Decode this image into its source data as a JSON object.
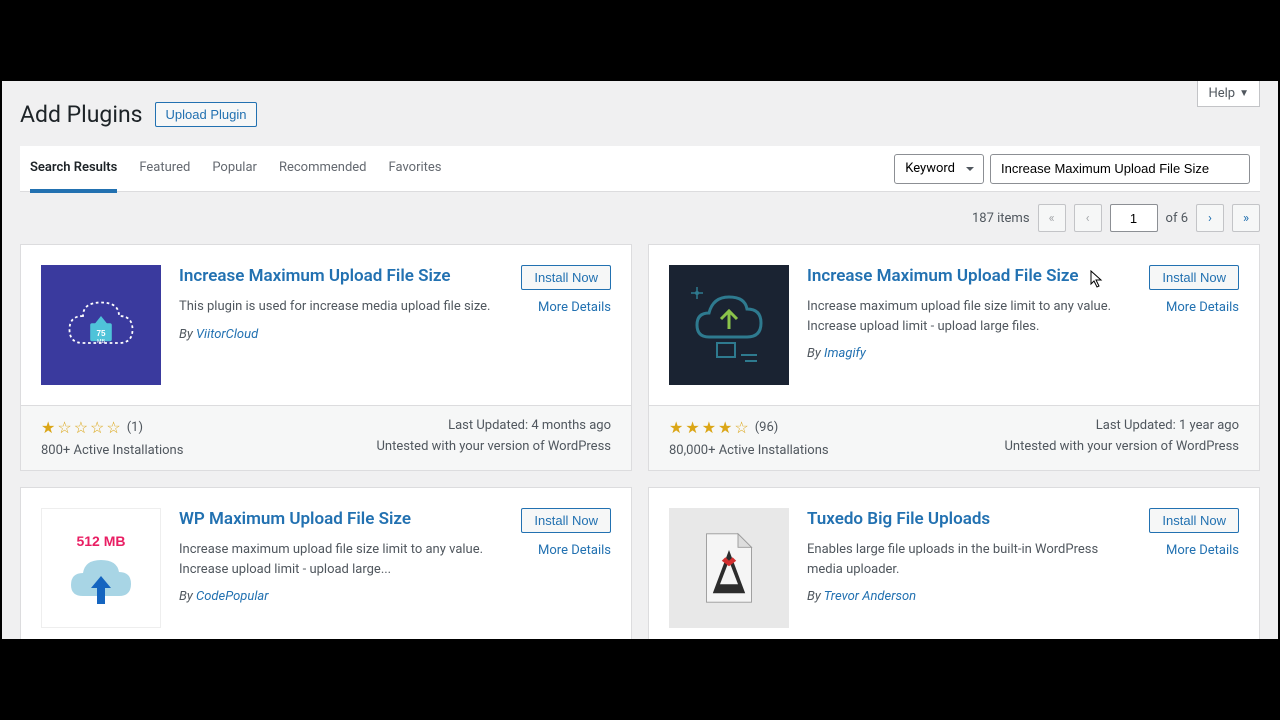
{
  "header": {
    "help_label": "Help",
    "page_title": "Add Plugins",
    "upload_label": "Upload Plugin"
  },
  "tabs": {
    "items": [
      "Search Results",
      "Featured",
      "Popular",
      "Recommended",
      "Favorites"
    ],
    "active": 0
  },
  "search": {
    "type_label": "Keyword",
    "query": "Increase Maximum Upload File Size"
  },
  "pagination": {
    "items_text": "187 items",
    "current": "1",
    "total_text": "of 6",
    "first": "«",
    "prev": "‹",
    "next": "›",
    "last": "»"
  },
  "common": {
    "install_label": "Install Now",
    "more_label": "More Details",
    "by_prefix": "By "
  },
  "plugins": [
    {
      "title": "Increase Maximum Upload File Size",
      "desc": "This plugin is used for increase media upload file size.",
      "author": "ViitorCloud",
      "rating_count": "(1)",
      "installs": "800+ Active Installations",
      "updated": "Last Updated: 4 months ago",
      "compat": "Untested with your version of WordPress"
    },
    {
      "title": "Increase Maximum Upload File Size",
      "desc": "Increase maximum upload file size limit to any value. Increase upload limit - upload large files.",
      "author": "Imagify",
      "rating_count": "(96)",
      "installs": "80,000+ Active Installations",
      "updated": "Last Updated: 1 year ago",
      "compat": "Untested with your version of WordPress"
    },
    {
      "title": "WP Maximum Upload File Size",
      "desc": "Increase maximum upload file size limit to any value. Increase upload limit - upload large...",
      "author": "CodePopular",
      "rating_count": "",
      "installs": "",
      "updated": "",
      "compat": ""
    },
    {
      "title": "Tuxedo Big File Uploads",
      "desc": "Enables large file uploads in the built-in WordPress media uploader.",
      "author": "Trevor Anderson",
      "rating_count": "",
      "installs": "",
      "updated": "",
      "compat": ""
    }
  ],
  "icons": {
    "p0_badge": "75 MB",
    "p2_badge": "512 MB"
  }
}
